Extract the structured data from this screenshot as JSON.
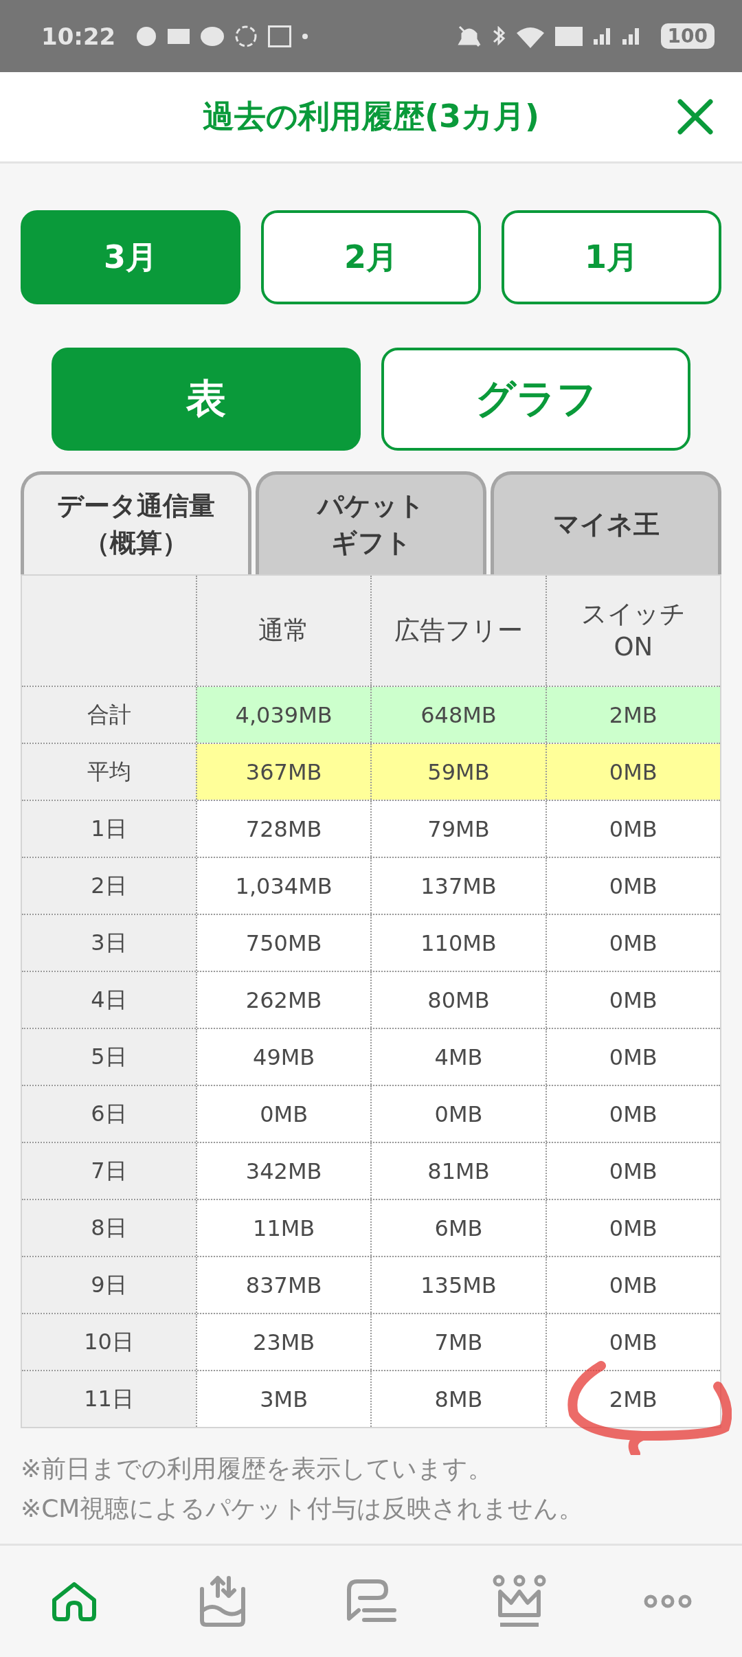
{
  "status_bar": {
    "time": "10:22",
    "battery": "100"
  },
  "header": {
    "title": "過去の利用履歴(3カ月)"
  },
  "months": [
    {
      "label": "3月",
      "selected": true
    },
    {
      "label": "2月",
      "selected": false
    },
    {
      "label": "1月",
      "selected": false
    }
  ],
  "views": [
    {
      "label": "表",
      "selected": true
    },
    {
      "label": "グラフ",
      "selected": false
    }
  ],
  "tabs": [
    {
      "lines": [
        "データ通信量",
        "（概算）"
      ],
      "selected": true
    },
    {
      "lines": [
        "パケット",
        "ギフト"
      ],
      "selected": false
    },
    {
      "lines": [
        "マイネ王"
      ],
      "selected": false
    }
  ],
  "table": {
    "columns": [
      {
        "lines": [
          "通常"
        ]
      },
      {
        "lines": [
          "広告フリー"
        ]
      },
      {
        "lines": [
          "スイッチ",
          "ON"
        ]
      }
    ],
    "rows": [
      {
        "label": "合計",
        "kind": "total",
        "values": [
          "4,039MB",
          "648MB",
          "2MB"
        ]
      },
      {
        "label": "平均",
        "kind": "average",
        "values": [
          "367MB",
          "59MB",
          "0MB"
        ]
      },
      {
        "label": "1日",
        "kind": "day",
        "values": [
          "728MB",
          "79MB",
          "0MB"
        ]
      },
      {
        "label": "2日",
        "kind": "day",
        "values": [
          "1,034MB",
          "137MB",
          "0MB"
        ]
      },
      {
        "label": "3日",
        "kind": "day",
        "values": [
          "750MB",
          "110MB",
          "0MB"
        ]
      },
      {
        "label": "4日",
        "kind": "day",
        "values": [
          "262MB",
          "80MB",
          "0MB"
        ]
      },
      {
        "label": "5日",
        "kind": "day",
        "values": [
          "49MB",
          "4MB",
          "0MB"
        ]
      },
      {
        "label": "6日",
        "kind": "day",
        "values": [
          "0MB",
          "0MB",
          "0MB"
        ]
      },
      {
        "label": "7日",
        "kind": "day",
        "values": [
          "342MB",
          "81MB",
          "0MB"
        ]
      },
      {
        "label": "8日",
        "kind": "day",
        "values": [
          "11MB",
          "6MB",
          "0MB"
        ]
      },
      {
        "label": "9日",
        "kind": "day",
        "values": [
          "837MB",
          "135MB",
          "0MB"
        ]
      },
      {
        "label": "10日",
        "kind": "day",
        "values": [
          "23MB",
          "7MB",
          "0MB"
        ]
      },
      {
        "label": "11日",
        "kind": "day",
        "values": [
          "3MB",
          "8MB",
          "2MB"
        ]
      }
    ]
  },
  "notes": [
    "※前日までの利用履歴を表示しています。",
    "※CM視聴によるパケット付与は反映されません。"
  ],
  "nav": [
    {
      "kind": "home",
      "selected": true
    },
    {
      "kind": "transfer",
      "selected": false
    },
    {
      "kind": "chat",
      "selected": false
    },
    {
      "kind": "crown",
      "selected": false
    },
    {
      "kind": "more",
      "selected": false
    }
  ]
}
